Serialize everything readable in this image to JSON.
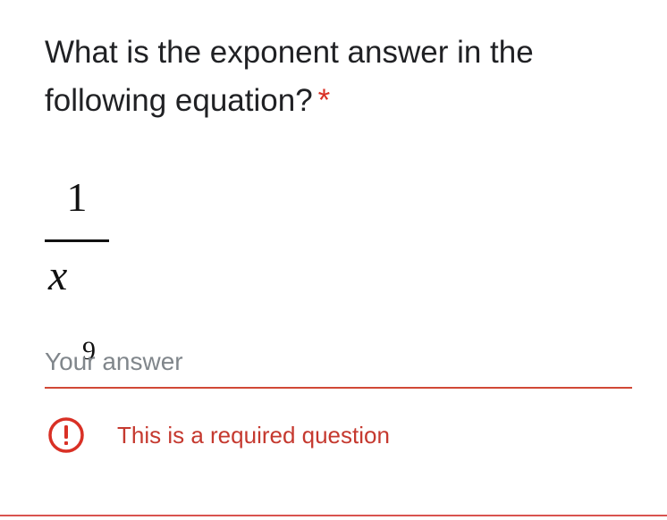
{
  "question": {
    "title": "What is the exponent answer in the following equation?",
    "required_marker": "*"
  },
  "equation": {
    "numerator": "1",
    "base": "x",
    "exponent": "9"
  },
  "answer": {
    "placeholder": "Your answer",
    "value": ""
  },
  "validation": {
    "icon": "error-icon",
    "message": "This is a required question",
    "color": "#d93025"
  },
  "colors": {
    "accent": "#d14836",
    "title_text": "#202124",
    "placeholder_text": "#80868b"
  }
}
